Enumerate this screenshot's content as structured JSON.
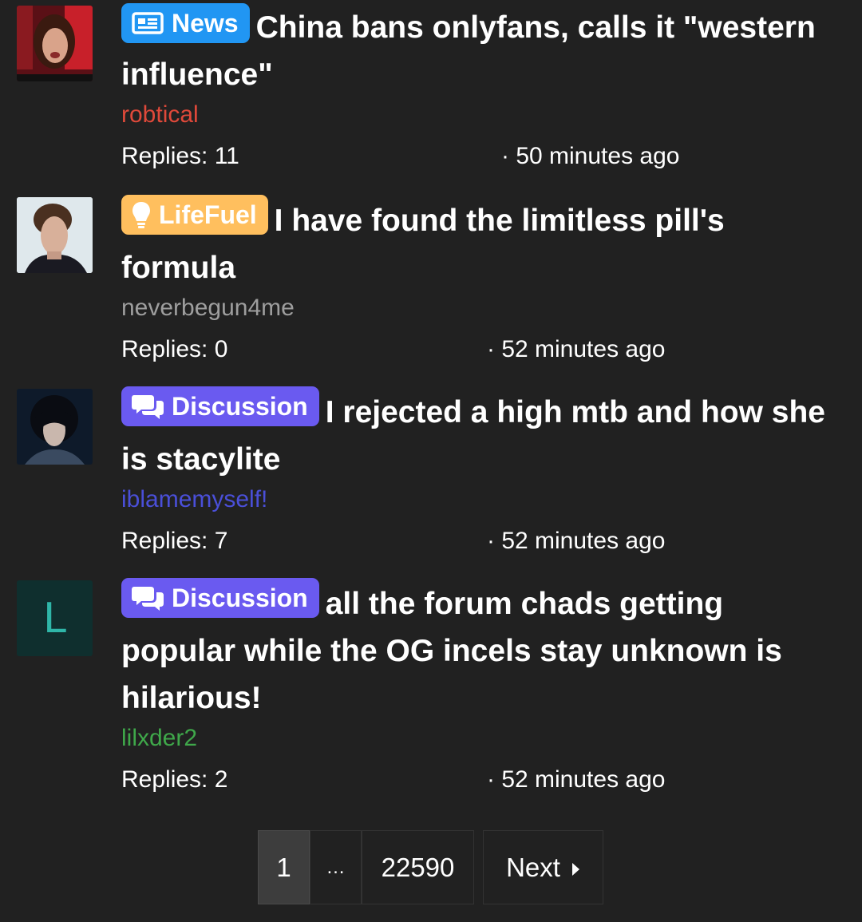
{
  "threads": [
    {
      "prefix": "News",
      "prefix_icon": "newspaper-icon",
      "prefix_color": "#2196f3",
      "title": "China bans onlyfans, calls it \"western influence\"",
      "author": "robtical",
      "author_color": "#e0493a",
      "replies": "Replies: 11",
      "time": "· 50 minutes ago"
    },
    {
      "prefix": "LifeFuel",
      "prefix_icon": "lightbulb-icon",
      "prefix_color": "#ffbf5e",
      "title": "I have found the limitless pill's formula",
      "author": "neverbegun4me",
      "author_color": "#9e9e9e",
      "replies": "Replies: 0",
      "time": "· 52 minutes ago"
    },
    {
      "prefix": "Discussion",
      "prefix_icon": "comments-icon",
      "prefix_color": "#6a5af0",
      "title": "I rejected a high mtb and how she is stacylite",
      "author": "iblamemyself!",
      "author_color": "#4a4fd8",
      "replies": "Replies: 7",
      "time": "· 52 minutes ago"
    },
    {
      "prefix": "Discussion",
      "prefix_icon": "comments-icon",
      "prefix_color": "#6a5af0",
      "title": "all the forum chads getting popular while the OG incels stay unknown is hilarious!",
      "author": "lilxder2",
      "author_color": "#3fa84a",
      "avatar_letter": "L",
      "avatar_bg": "#0f2f2e",
      "avatar_fg": "#2fb6a8",
      "replies": "Replies: 2",
      "time": "· 52 minutes ago"
    }
  ],
  "pagination": {
    "current": "1",
    "ellipsis": "…",
    "last": "22590",
    "next": "Next"
  }
}
